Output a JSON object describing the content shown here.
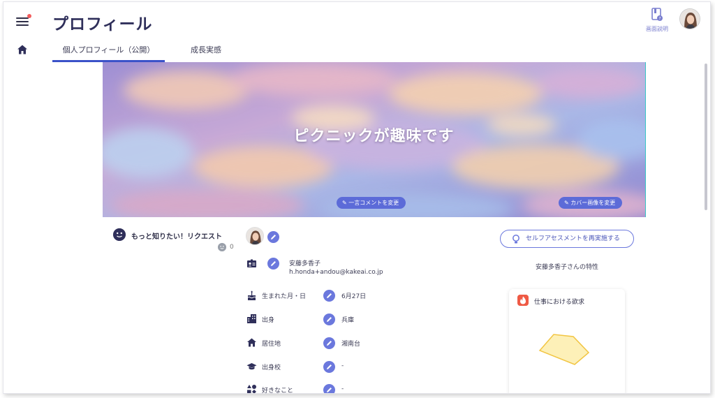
{
  "header": {
    "title": "プロフィール",
    "guide_label": "画面説明"
  },
  "tabs": [
    {
      "label": "個人プロフィール（公開）",
      "active": true
    },
    {
      "label": "成長実感",
      "active": false
    }
  ],
  "cover": {
    "title": "ピクニックが趣味です",
    "comment_button": "一言コメントを変更",
    "cover_button": "カバー画像を変更"
  },
  "request": {
    "label": "もっと知りたい！リクエスト",
    "count": "0"
  },
  "profile": {
    "name": "安藤多香子",
    "email": "h.honda+andou@kakeai.co.jp",
    "rows": [
      {
        "icon": "cake-icon",
        "label": "生まれた月・日",
        "value": "6月27日"
      },
      {
        "icon": "building-icon",
        "label": "出身",
        "value": "兵庫"
      },
      {
        "icon": "house-icon",
        "label": "居住地",
        "value": "湘南台"
      },
      {
        "icon": "graduation-cap-icon",
        "label": "出身校",
        "value": "-"
      },
      {
        "icon": "shapes-icon",
        "label": "好きなこと",
        "value": "-"
      }
    ]
  },
  "assessment": {
    "button_label": "セルフアセスメントを再実施する",
    "traits_label": "安藤多香子さんの特性",
    "card_title": "仕事における欲求"
  },
  "colors": {
    "accent": "#6b78dd",
    "title": "#2f2f5a",
    "tab_underline": "#3b52c9",
    "notify": "#f25c5c",
    "flame": "#ef5a45",
    "radar_fill": "#fdf0b8",
    "radar_stroke": "#f2c542"
  }
}
